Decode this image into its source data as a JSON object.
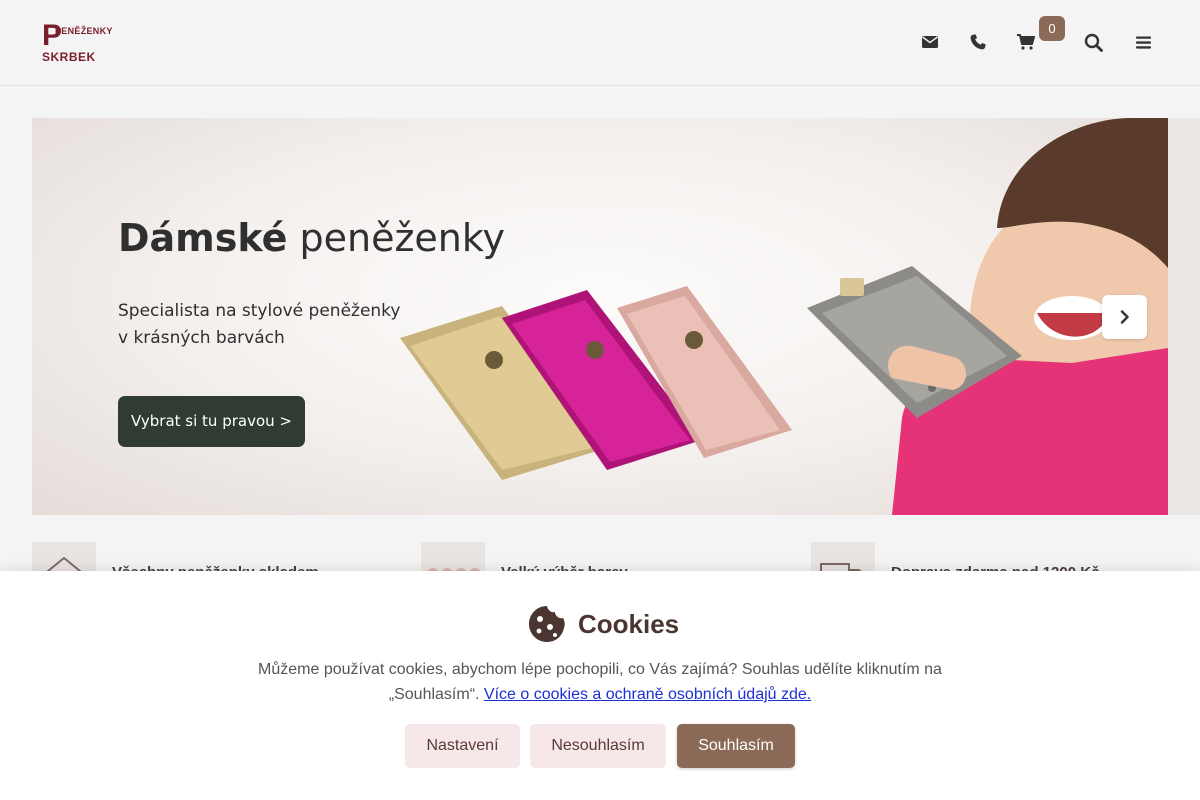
{
  "header": {
    "logo_top": "PENĚŽENKY",
    "logo_bottom": "SKRBEK",
    "logo_p": "P",
    "icons": [
      "envelope-icon",
      "phone-icon",
      "cart-icon",
      "search-icon",
      "menu-icon"
    ],
    "cart_count": "0"
  },
  "banner": {
    "title_bold": "Dámské",
    "title_rest": " peněženky",
    "subtitle_line1": "Specialista na stylové peněženky",
    "subtitle_line2": "v krásných barvách",
    "cta": "Vybrat si tu pravou >"
  },
  "features": [
    {
      "text": "Všechny peněženky skladem",
      "icon": "warehouse-icon"
    },
    {
      "text": "Velký výběr barev",
      "icon": "colors-icon"
    },
    {
      "text": "Doprava zdarma nad 1200 Kč",
      "icon": "truck-icon"
    }
  ],
  "cookie": {
    "title": "Cookies",
    "text_part1": "Můžeme používat cookies, abychom lépe pochopili, co Vás zajímá? Souhlas udělíte kliknutím na „Souhlasím“. ",
    "link": "Více o cookies a ochraně osobních údajů zde.",
    "btn_settings": "Nastavení",
    "btn_reject": "Nesouhlasím",
    "btn_accept": "Souhlasím"
  },
  "colors": {
    "brand": "#7a1d2c",
    "accent": "#8c6a58",
    "cta_dark": "#2f3b33",
    "link": "#1d2fd6"
  }
}
